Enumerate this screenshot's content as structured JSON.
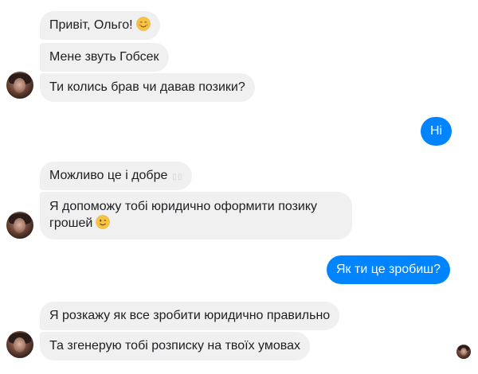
{
  "messages": [
    {
      "text": "Привіт, Ольго!",
      "emoji": "smiling-blush-emoji"
    },
    {
      "text": "Мене звуть Гобсек"
    },
    {
      "text": "Ти колись брав чи давав позики?"
    },
    {
      "text": "Ні"
    },
    {
      "text": "Можливо це і добре",
      "trailing": "▯▯"
    },
    {
      "text": "Я допоможу тобі юридично оформити позику грошей",
      "emoji": "winking-emoji"
    },
    {
      "text": "Як ти це зробиш?"
    },
    {
      "text": "Я розкажу як все зробити юридично правильно"
    },
    {
      "text": "Та згенерую тобі розписку на твоїх умовах"
    }
  ],
  "colors": {
    "incoming_bubble": "#f1f0f0",
    "outgoing_bubble": "#0084ff",
    "incoming_text": "#1c1e21",
    "outgoing_text": "#ffffff"
  }
}
